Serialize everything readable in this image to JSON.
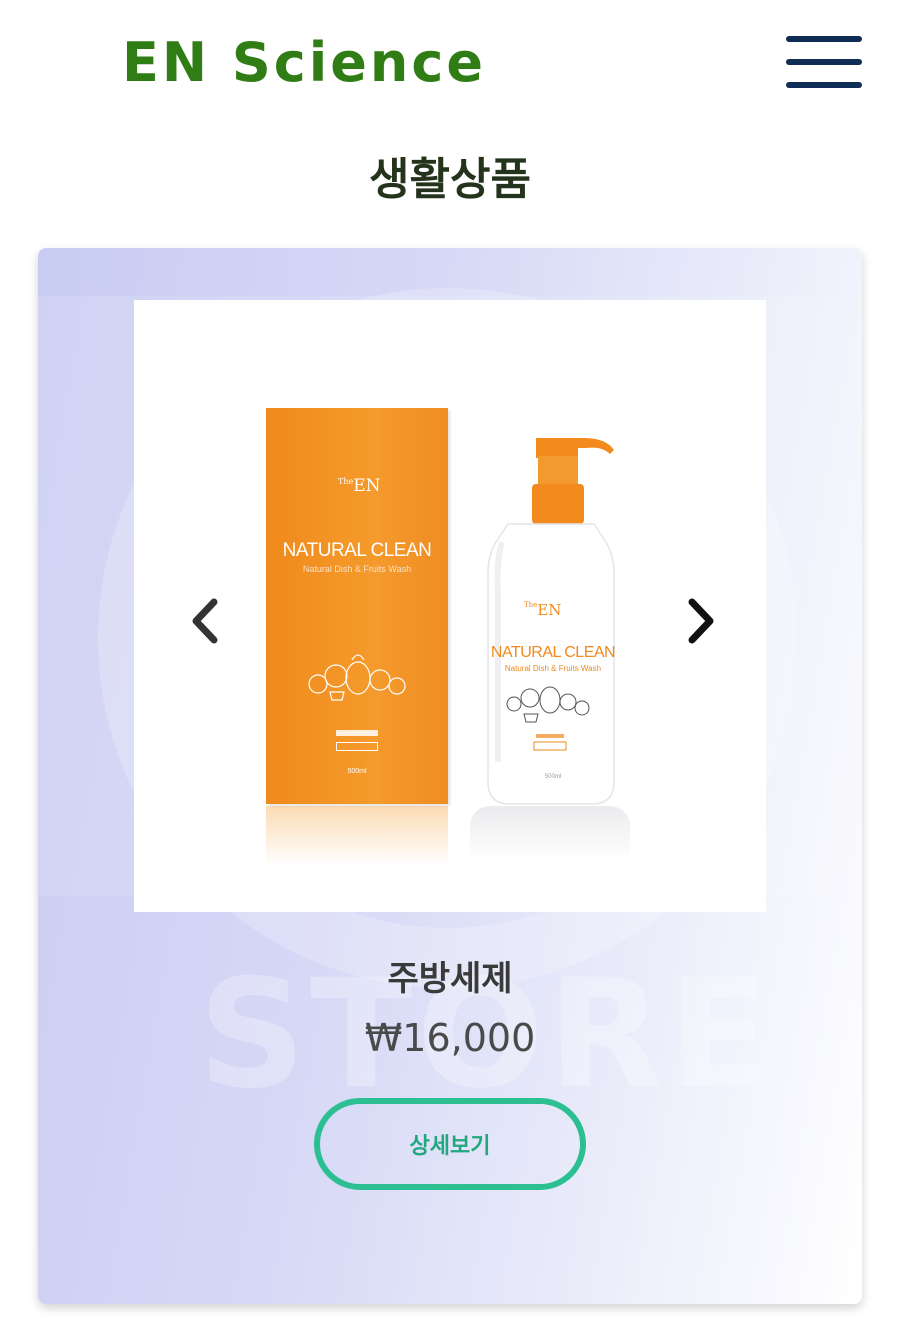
{
  "header": {
    "logo_text": "EN Science",
    "menu_icon": "hamburger-menu-icon"
  },
  "page": {
    "title": "생활상품"
  },
  "product": {
    "name": "주방세제",
    "price": "₩16,000",
    "detail_button_label": "상세보기",
    "watermark_text": "STORE",
    "image": {
      "brand_the": "The",
      "brand_en": "EN",
      "product_line": "NATURAL CLEAN",
      "product_sub": "Natural Dish & Fruits Wash",
      "volume": "500ml"
    }
  },
  "carousel": {
    "prev_icon": "chevron-left-icon",
    "next_icon": "chevron-right-icon"
  },
  "colors": {
    "logo_green": "#2f7d14",
    "menu_navy": "#0f2d55",
    "accent_teal": "#2bbf92",
    "product_orange": "#f08a1c"
  }
}
